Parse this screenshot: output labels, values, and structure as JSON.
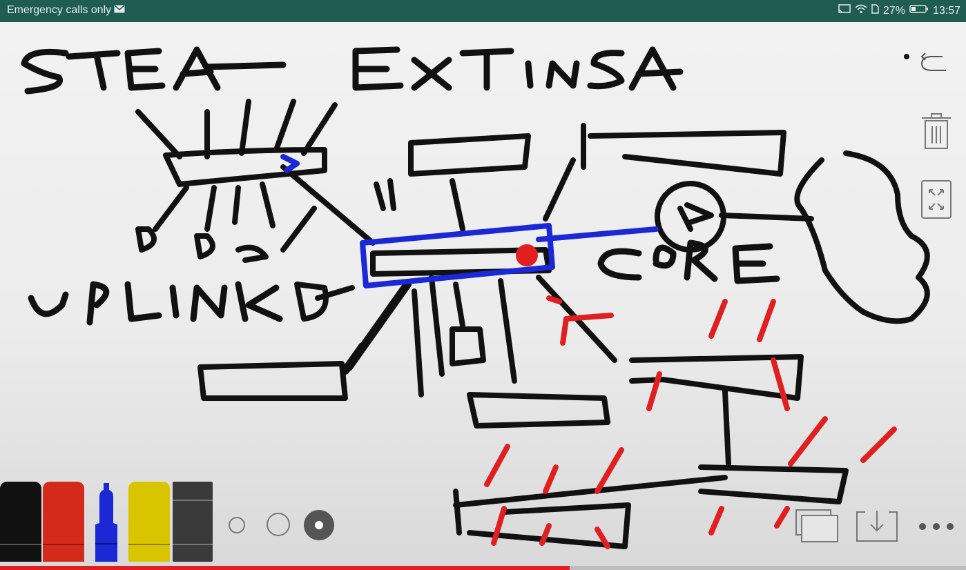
{
  "status_bar": {
    "left_text": "Emergency calls only",
    "battery_percent": "27%",
    "time": "13:57"
  },
  "canvas": {
    "handwritten_labels": [
      "STEA",
      "EXTINSA",
      "UPLINK",
      "CORE"
    ]
  },
  "toolbar": {
    "markers": [
      {
        "name": "black",
        "color": "#111111"
      },
      {
        "name": "red",
        "color": "#d42a1c"
      },
      {
        "name": "blue",
        "color": "#1a28d6"
      },
      {
        "name": "yellow",
        "color": "#d9c400"
      },
      {
        "name": "eraser",
        "color": "#3a3a3a"
      }
    ],
    "stroke_sizes": [
      "small",
      "medium",
      "large"
    ],
    "selected_stroke": "large"
  },
  "playback": {
    "progress_fraction": 0.59
  },
  "colors": {
    "status_bar_bg": "#1f5d52",
    "accent_red": "#e02020"
  }
}
